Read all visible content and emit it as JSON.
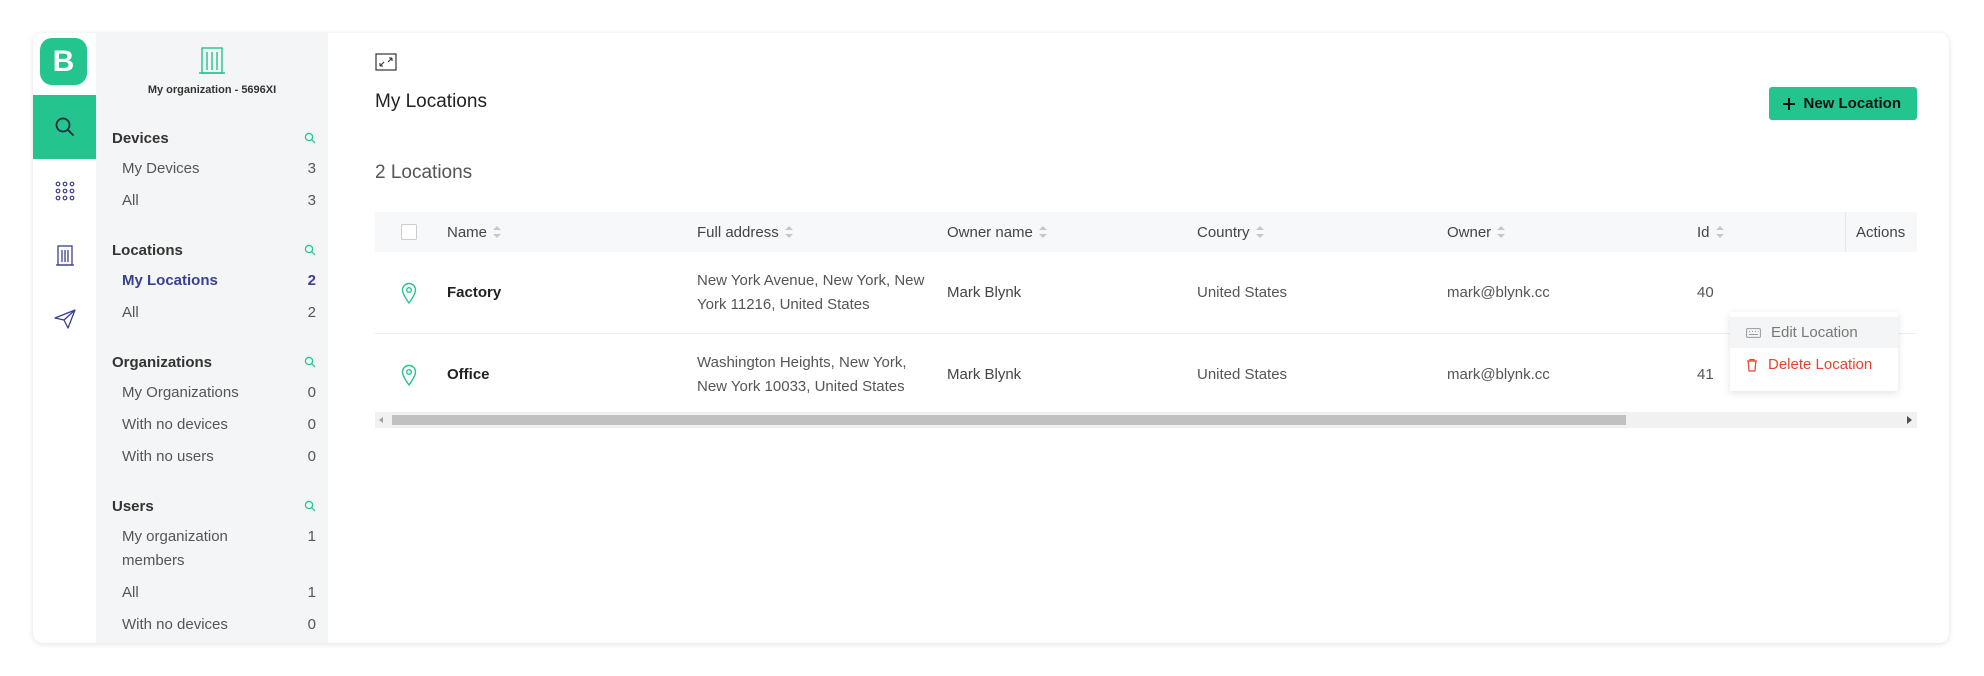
{
  "rail": {
    "logo_letter": "B",
    "items": [
      {
        "icon": "search-icon",
        "active": true
      },
      {
        "icon": "grid-icon",
        "active": false
      },
      {
        "icon": "building-icon",
        "active": false
      },
      {
        "icon": "send-icon",
        "active": false
      }
    ]
  },
  "sidebar": {
    "org_name": "My organization - 5696XI",
    "sections": [
      {
        "title": "Devices",
        "items": [
          {
            "label": "My Devices",
            "count": "3"
          },
          {
            "label": "All",
            "count": "3"
          }
        ]
      },
      {
        "title": "Locations",
        "items": [
          {
            "label": "My Locations",
            "count": "2",
            "active": true
          },
          {
            "label": "All",
            "count": "2"
          }
        ]
      },
      {
        "title": "Organizations",
        "items": [
          {
            "label": "My Organizations",
            "count": "0"
          },
          {
            "label": "With no devices",
            "count": "0"
          },
          {
            "label": "With no users",
            "count": "0"
          }
        ]
      },
      {
        "title": "Users",
        "items": [
          {
            "label": "My organization members",
            "count": "1"
          },
          {
            "label": "All",
            "count": "1"
          },
          {
            "label": "With no devices",
            "count": "0"
          }
        ]
      }
    ]
  },
  "main": {
    "title": "My Locations",
    "new_button_label": "New Location",
    "count_label": "2 Locations",
    "columns": [
      "Name",
      "Full address",
      "Owner name",
      "Country",
      "Owner",
      "Id",
      "Actions"
    ],
    "rows": [
      {
        "name": "Factory",
        "address": "New York Avenue, New York, New York 11216, United States",
        "owner_name": "Mark Blynk",
        "country": "United States",
        "owner": "mark@blynk.cc",
        "id": "40"
      },
      {
        "name": "Office",
        "address": "Washington Heights, New York, New York 10033, United States",
        "owner_name": "Mark Blynk",
        "country": "United States",
        "owner": "mark@blynk.cc",
        "id": "41"
      }
    ],
    "context_menu": {
      "edit_label": "Edit Location",
      "delete_label": "Delete Location"
    }
  },
  "colors": {
    "accent": "#23c48e",
    "active_nav": "#3a3f8f",
    "danger": "#e8442d"
  }
}
